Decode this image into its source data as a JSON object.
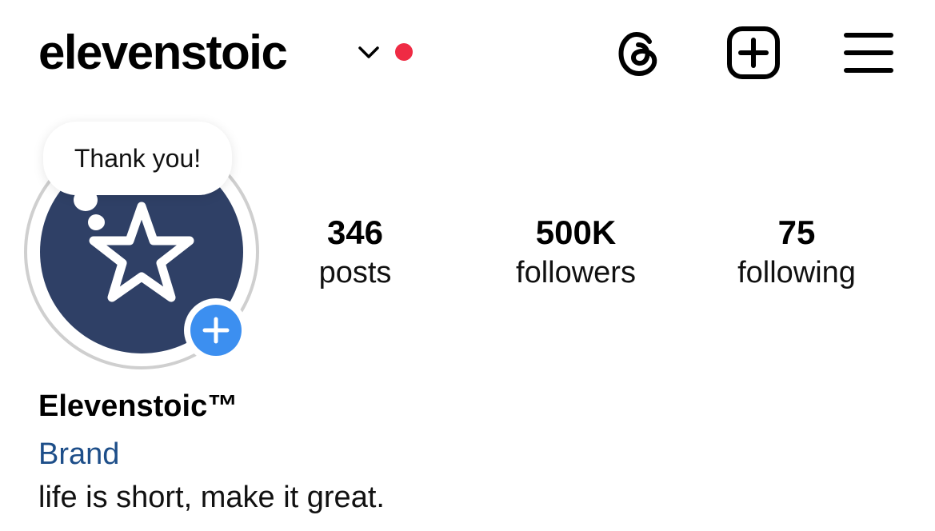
{
  "header": {
    "username": "elevenstoic",
    "icons": {
      "switch_account": "chevron-down-icon",
      "notification_dot": "red-dot-icon",
      "threads": "threads-icon",
      "create": "add-square-icon",
      "menu": "hamburger-menu-icon"
    },
    "notification_dot_color": "#ef2b44"
  },
  "profile": {
    "note_text": "Thank you!",
    "avatar_icon": "star-logo-icon",
    "avatar_color": "#2f4066",
    "add_story_icon": "plus-icon",
    "add_story_color": "#3c8ff0"
  },
  "stats": {
    "posts": {
      "value": "346",
      "label": "posts"
    },
    "followers": {
      "value": "500K",
      "label": "followers"
    },
    "following": {
      "value": "75",
      "label": "following"
    }
  },
  "bio": {
    "display_name": "Elevenstoic™",
    "category": "Brand",
    "category_color": "#1d4e89",
    "text": "life is short, make it great."
  }
}
